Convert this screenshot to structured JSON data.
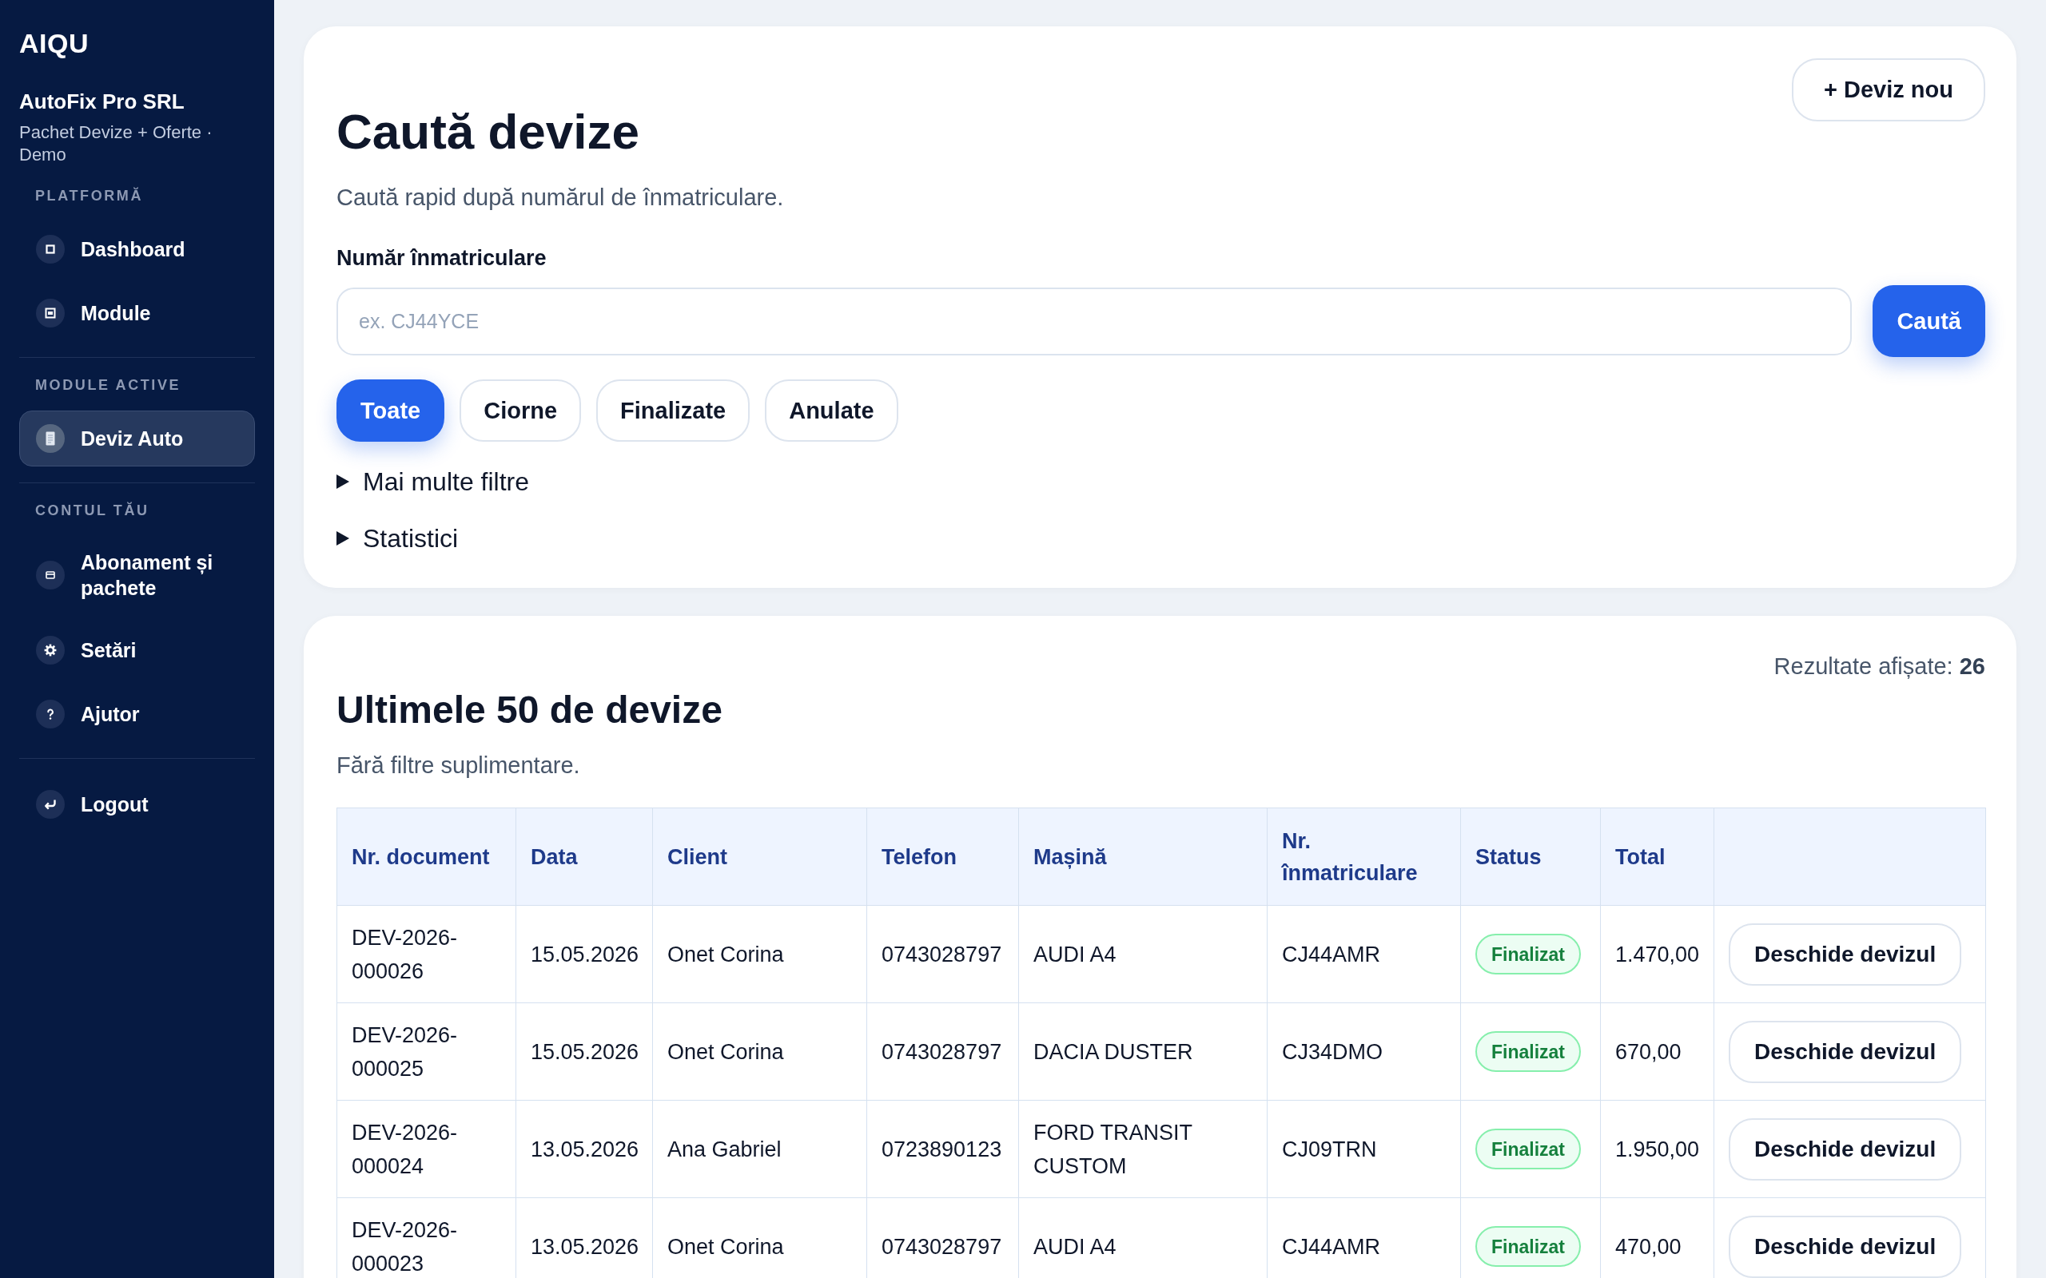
{
  "sidebar": {
    "logo": "AIQU",
    "company": "AutoFix Pro SRL",
    "plan": "Pachet Devize + Oferte · Demo",
    "sections": [
      {
        "title": "PLATFORMĂ",
        "items": [
          {
            "label": "Dashboard",
            "selected": false
          },
          {
            "label": "Module",
            "selected": false
          }
        ]
      },
      {
        "title": "MODULE ACTIVE",
        "items": [
          {
            "label": "Deviz Auto",
            "selected": true
          }
        ]
      },
      {
        "title": "CONTUL TĂU",
        "items": [
          {
            "label": "Abonament și pachete",
            "selected": false
          },
          {
            "label": "Setări",
            "selected": false
          },
          {
            "label": "Ajutor",
            "selected": false
          }
        ]
      },
      {
        "items": [
          {
            "label": "Logout",
            "selected": false
          }
        ]
      }
    ]
  },
  "search_card": {
    "title": "Caută devize",
    "subtitle": "Caută rapid după numărul de înmatriculare.",
    "new_button": "+ Deviz nou",
    "field": {
      "label": "Număr înmatriculare",
      "placeholder": "ex. CJ44YCE"
    },
    "search_button": "Caută",
    "filters": [
      {
        "label": "Toate",
        "selected": true
      },
      {
        "label": "Ciorne",
        "selected": false
      },
      {
        "label": "Finalizate",
        "selected": false
      },
      {
        "label": "Anulate",
        "selected": false
      }
    ],
    "disclosures": [
      {
        "label": "Mai multe filtre",
        "expanded": false
      },
      {
        "label": "Statistici",
        "expanded": false
      }
    ]
  },
  "results_card": {
    "results": "Rezultate afișate: **26**",
    "title": "Ultimele 50 de devize",
    "subtitle": "Fără filtre suplimentare.",
    "table": {
      "columns": [
        "Nr. document",
        "Data",
        "Client",
        "Telefon",
        "Mașină",
        "Nr. înmatriculare",
        "Status",
        "Total"
      ],
      "rows": [
        {
          "cells": [
            "DEV-2026-000026",
            "15.05.2026",
            "Onet Corina",
            "0743028797",
            "AUDI A4",
            "CJ44AMR"
          ],
          "status": "Finalizat",
          "total": "1.470,00",
          "action": "Deschide devizul"
        },
        {
          "cells": [
            "DEV-2026-000025",
            "15.05.2026",
            "Onet Corina",
            "0743028797",
            "DACIA DUSTER",
            "CJ34DMO"
          ],
          "status": "Finalizat",
          "total": "670,00",
          "action": "Deschide devizul"
        },
        {
          "cells": [
            "DEV-2026-000024",
            "13.05.2026",
            "Ana Gabriel",
            "0723890123",
            "FORD TRANSIT CUSTOM",
            "CJ09TRN"
          ],
          "status": "Finalizat",
          "total": "1.950,00",
          "action": "Deschide devizul"
        },
        {
          "cells": [
            "DEV-2026-000023",
            "13.05.2026",
            "Onet Corina",
            "0743028797",
            "AUDI A4",
            "CJ44AMR"
          ],
          "status": "Finalizat",
          "total": "470,00",
          "action": "Deschide devizul"
        }
      ]
    }
  }
}
